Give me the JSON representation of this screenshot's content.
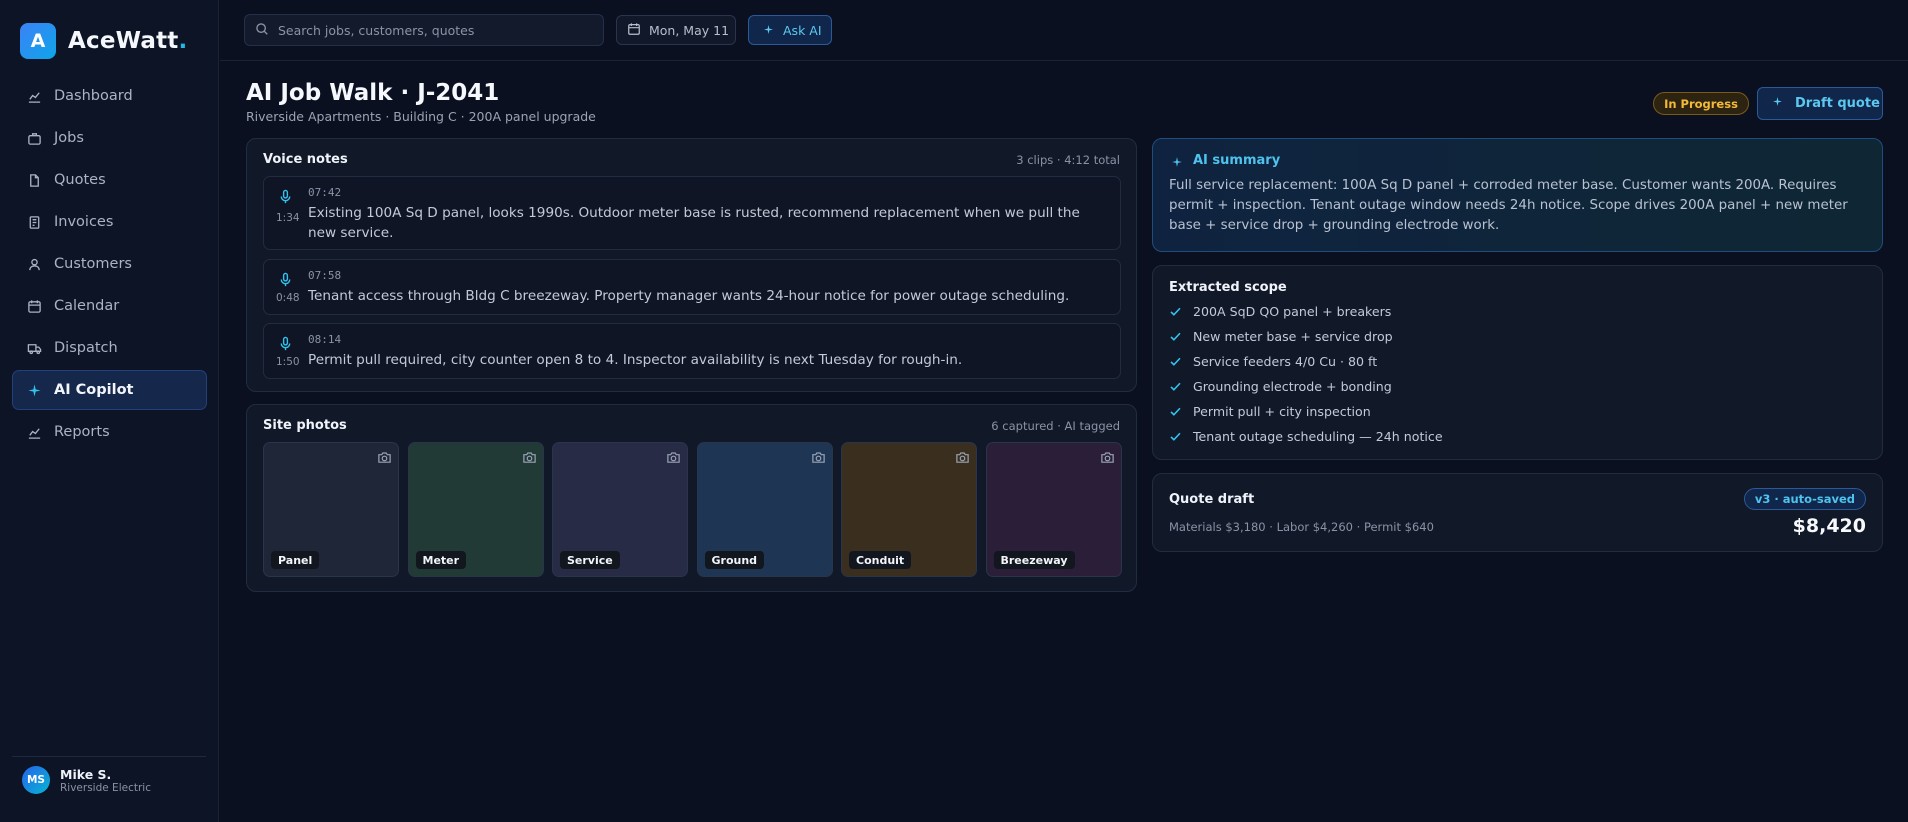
{
  "brand": {
    "logo_letter": "A",
    "name": "AceWatt",
    "dot": "."
  },
  "sidebar": {
    "items": [
      {
        "label": "Dashboard",
        "icon": "chart-line-icon"
      },
      {
        "label": "Jobs",
        "icon": "briefcase-icon"
      },
      {
        "label": "Quotes",
        "icon": "document-icon"
      },
      {
        "label": "Invoices",
        "icon": "receipt-icon"
      },
      {
        "label": "Customers",
        "icon": "user-icon"
      },
      {
        "label": "Calendar",
        "icon": "calendar-icon"
      },
      {
        "label": "Dispatch",
        "icon": "truck-icon"
      },
      {
        "label": "AI Copilot",
        "icon": "sparkle-icon",
        "active": true
      },
      {
        "label": "Reports",
        "icon": "chart-line-icon"
      }
    ]
  },
  "user": {
    "initials": "MS",
    "name": "Mike S.",
    "org": "Riverside Electric"
  },
  "topbar": {
    "search_placeholder": "Search jobs, customers, quotes",
    "date": "Mon, May 11",
    "ask_ai": "Ask AI"
  },
  "header": {
    "title": "AI Job Walk · J-2041",
    "subtitle": "Riverside Apartments · Building C · 200A panel upgrade",
    "status": "In Progress",
    "draft_button": "Draft quote"
  },
  "voice": {
    "title": "Voice notes",
    "meta": "3 clips · 4:12 total",
    "clips": [
      {
        "time": "07:42",
        "duration": "1:34",
        "text": "Existing 100A Sq D panel, looks 1990s. Outdoor meter base is rusted, recommend replacement when we pull the new service."
      },
      {
        "time": "07:58",
        "duration": "0:48",
        "text": "Tenant access through Bldg C breezeway. Property manager wants 24-hour notice for power outage scheduling."
      },
      {
        "time": "08:14",
        "duration": "1:50",
        "text": "Permit pull required, city counter open 8 to 4. Inspector availability is next Tuesday for rough-in."
      }
    ]
  },
  "photos": {
    "title": "Site photos",
    "meta": "6 captured · AI tagged",
    "items": [
      {
        "label": "Panel",
        "color": "#1e2638"
      },
      {
        "label": "Meter",
        "color": "#213a36"
      },
      {
        "label": "Service",
        "color": "#272b46"
      },
      {
        "label": "Ground",
        "color": "#1e3554"
      },
      {
        "label": "Conduit",
        "color": "#3a2f1e"
      },
      {
        "label": "Breezeway",
        "color": "#2a1e38"
      }
    ]
  },
  "ai_summary": {
    "title": "AI summary",
    "text": "Full service replacement: 100A Sq D panel + corroded meter base. Customer wants 200A. Requires permit + inspection. Tenant outage window needs 24h notice. Scope drives 200A panel + new meter base + service drop + grounding electrode work."
  },
  "scope": {
    "title": "Extracted scope",
    "items": [
      "200A SqD QO panel + breakers",
      "New meter base + service drop",
      "Service feeders 4/0 Cu · 80 ft",
      "Grounding electrode + bonding",
      "Permit pull + city inspection",
      "Tenant outage scheduling — 24h notice"
    ]
  },
  "quote": {
    "title": "Quote draft",
    "version": "v3 · auto-saved",
    "breakdown": "Materials $3,180 · Labor $4,260 · Permit $640",
    "total": "$8,420"
  },
  "colors": {
    "accent": "#22b8e6",
    "status": "#f5b93a",
    "background": "#0b1020"
  }
}
